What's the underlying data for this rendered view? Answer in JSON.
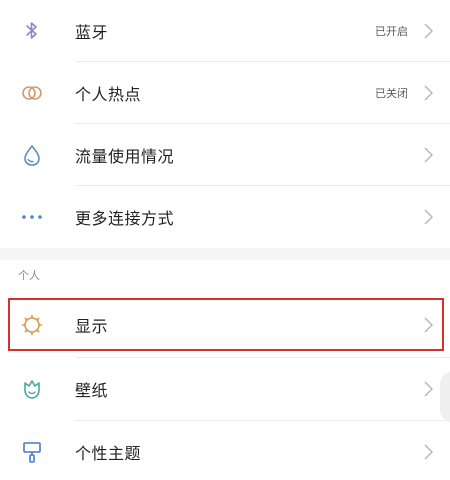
{
  "items": [
    {
      "id": "bluetooth",
      "label": "蓝牙",
      "status": "已开启",
      "icon": "bluetooth-icon"
    },
    {
      "id": "hotspot",
      "label": "个人热点",
      "status": "已关闭",
      "icon": "hotspot-icon"
    },
    {
      "id": "data-usage",
      "label": "流量使用情况",
      "status": "",
      "icon": "water-drop-icon"
    },
    {
      "id": "more-connections",
      "label": "更多连接方式",
      "status": "",
      "icon": "more-dots-icon"
    }
  ],
  "section_personal": {
    "header": "个人",
    "items": [
      {
        "id": "display",
        "label": "显示",
        "icon": "sun-gear-icon"
      },
      {
        "id": "wallpaper",
        "label": "壁纸",
        "icon": "tulip-icon"
      },
      {
        "id": "themes",
        "label": "个性主题",
        "icon": "paint-roller-icon"
      }
    ]
  },
  "colors": {
    "bluetooth": "#8f84c8",
    "hotspot": "#d59a6b",
    "data_usage": "#5a8ec5",
    "more": "#3f86d6",
    "display": "#d59a4f",
    "wallpaper": "#4aa59a",
    "themes": "#3f7ad1",
    "highlight": "#d6312f"
  }
}
